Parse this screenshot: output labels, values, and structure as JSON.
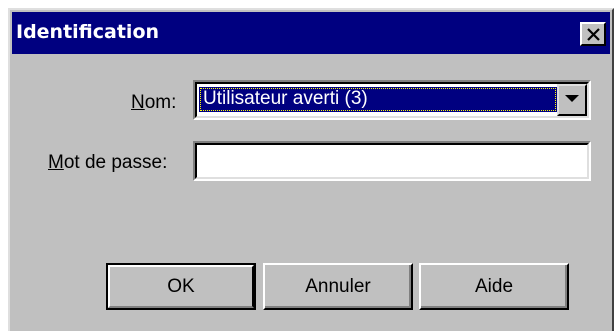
{
  "window": {
    "title": "Identification"
  },
  "form": {
    "nom_label_accel": "N",
    "nom_label_rest": "om:",
    "nom_value": "Utilisateur averti (3)",
    "password_label_accel": "M",
    "password_label_rest": "ot de passe:",
    "password_value": ""
  },
  "buttons": {
    "ok": "OK",
    "cancel": "Annuler",
    "help": "Aide"
  },
  "colors": {
    "titlebar": "#000080",
    "face": "#c0c0c0",
    "selection": "#000080"
  },
  "icons": {
    "close": "close-icon",
    "dropdown": "chevron-down-icon"
  }
}
